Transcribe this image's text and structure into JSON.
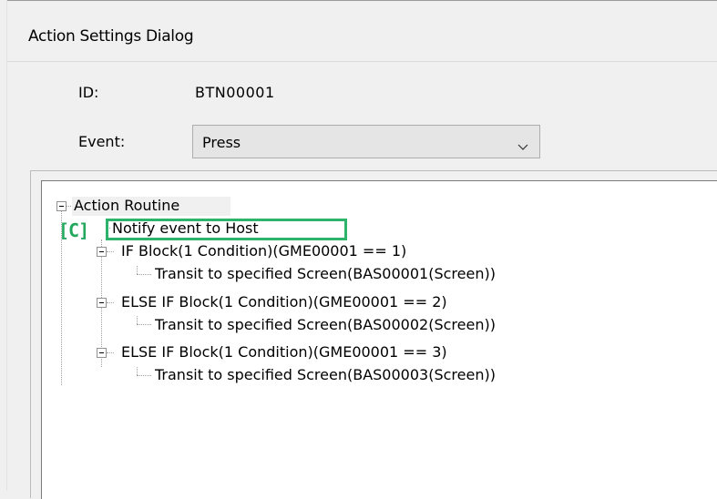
{
  "dialog": {
    "title": "Action Settings Dialog"
  },
  "form": {
    "id_label": "ID:",
    "id_value": "BTN00001",
    "event_label": "Event:",
    "event_value": "Press"
  },
  "tree": {
    "root": "Action Routine",
    "items": [
      "Notify event to Host",
      "IF Block(1 Condition)(GME00001 == 1)",
      "Transit to specified Screen(BAS00001(Screen))",
      "ELSE IF Block(1 Condition)(GME00001 == 2)",
      "Transit to specified Screen(BAS00002(Screen))",
      "ELSE IF Block(1 Condition)(GME00001 == 3)",
      "Transit to specified Screen(BAS00003(Screen))"
    ]
  },
  "annotation": {
    "label": "[C]",
    "color": "#2eb36a"
  },
  "icons": [
    "chevron-down-icon",
    "collapse-icon"
  ]
}
